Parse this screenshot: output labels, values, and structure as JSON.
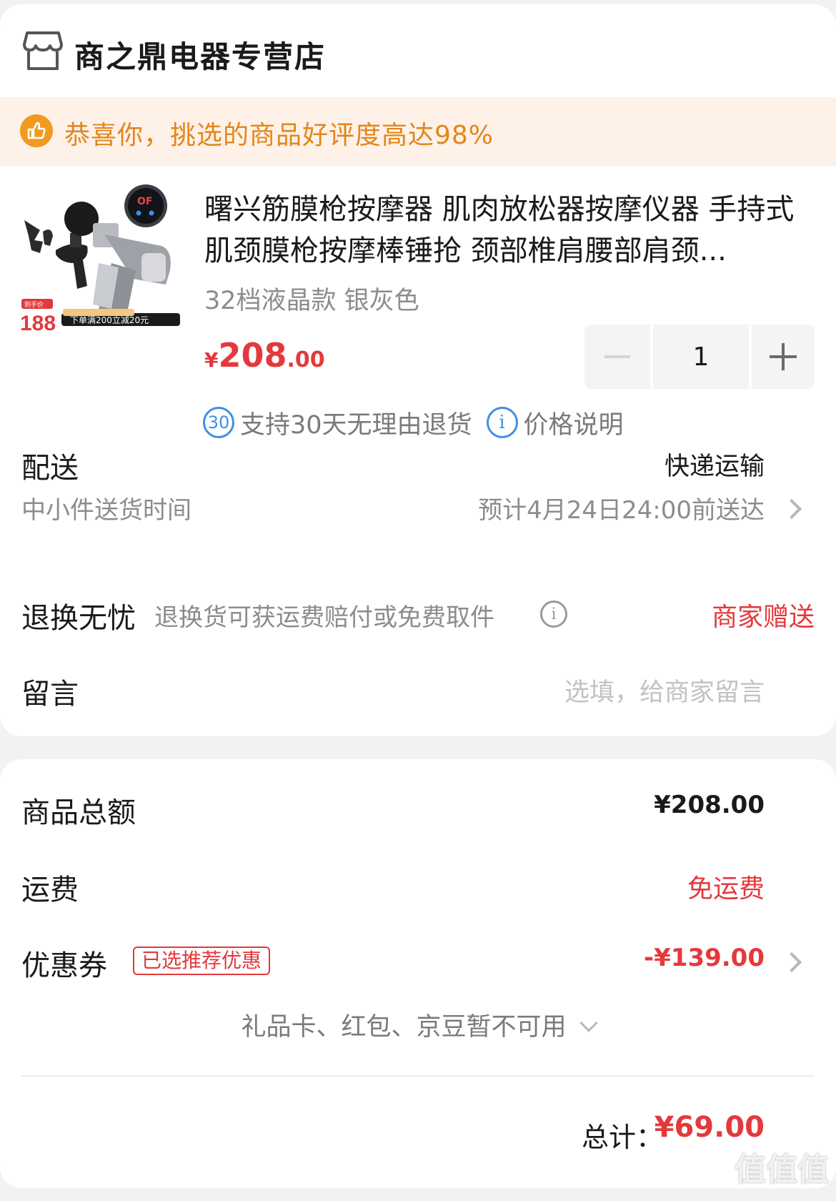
{
  "store": {
    "name": "商之鼎电器专营店"
  },
  "rating_banner": {
    "text": "恭喜你，挑选的商品好评度高达98%"
  },
  "product": {
    "image_price": "188",
    "image_price_label": "到手价",
    "image_promo": "下单满200立减20元",
    "title": "曙兴筋膜枪按摩器 肌肉放松器按摩仪器 手持式肌颈膜枪按摩棒锤抢 颈部椎肩腰部肩颈...",
    "variant": "32档液晶款 银灰色",
    "price_currency": "¥",
    "price_int": "208",
    "price_dec": ".00",
    "quantity": "1",
    "minus_label": "−",
    "plus_label": "+"
  },
  "services": {
    "return_badge": "30",
    "return_text": "支持30天无理由退货",
    "price_info_icon": "i",
    "price_info_text": "价格说明"
  },
  "delivery": {
    "label": "配送",
    "method": "快递运输",
    "time_label": "中小件送货时间",
    "eta": "预计4月24日24:00前送达"
  },
  "return_worry_free": {
    "label": "退换无忧",
    "desc": "退换货可获运费赔付或免费取件",
    "info_icon": "i",
    "value": "商家赠送"
  },
  "message": {
    "label": "留言",
    "placeholder": "选填，给商家留言"
  },
  "summary": {
    "goods_total_label": "商品总额",
    "goods_total_value": "¥208.00",
    "shipping_label": "运费",
    "shipping_value": "免运费",
    "coupon_label": "优惠券",
    "coupon_tag": "已选推荐优惠",
    "coupon_value": "-¥139.00",
    "gift_note": "礼品卡、红包、京豆暂不可用",
    "total_label": "总计：",
    "total_value": "¥69.00"
  },
  "watermark": "值值值",
  "colors": {
    "accent_red": "#e4393c",
    "banner_bg": "#fdf1e8",
    "banner_text": "#e2861a",
    "info_blue": "#3f8fe6"
  }
}
